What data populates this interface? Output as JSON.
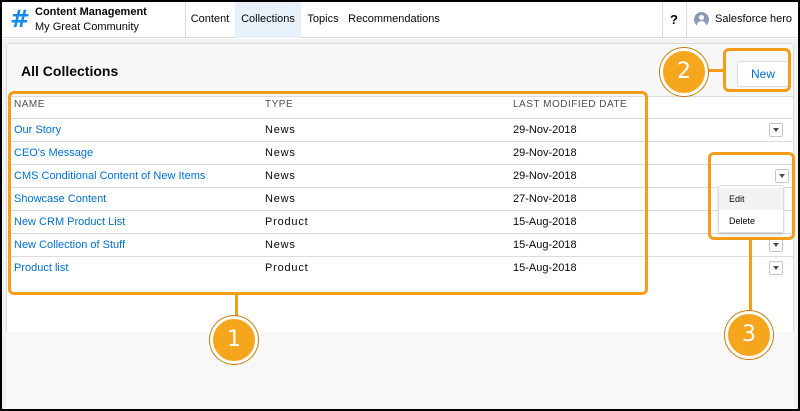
{
  "app": {
    "title": "Content Management",
    "community": "My Great Community"
  },
  "tabs": [
    {
      "label": "Content",
      "active": false
    },
    {
      "label": "Collections",
      "active": true
    },
    {
      "label": "Topics",
      "active": false
    },
    {
      "label": "Recommendations",
      "active": false
    }
  ],
  "header": {
    "help": "?",
    "user": "Salesforce hero"
  },
  "page": {
    "title": "All Collections",
    "new_button": "New"
  },
  "table": {
    "columns": [
      "NAME",
      "TYPE",
      "LAST MODIFIED DATE"
    ],
    "rows": [
      {
        "name": "Our Story",
        "type": "News",
        "date": "29-Nov-2018"
      },
      {
        "name": "CEO's Message",
        "type": "News",
        "date": "29-Nov-2018"
      },
      {
        "name": "CMS Conditional Content of New Items",
        "type": "News",
        "date": "29-Nov-2018"
      },
      {
        "name": "Showcase Content",
        "type": "News",
        "date": "27-Nov-2018"
      },
      {
        "name": "New CRM Product List",
        "type": "Product",
        "date": "15-Aug-2018"
      },
      {
        "name": "New Collection of Stuff",
        "type": "News",
        "date": "15-Aug-2018"
      },
      {
        "name": "Product list",
        "type": "Product",
        "date": "15-Aug-2018"
      }
    ]
  },
  "row_menu": {
    "items": [
      "Edit",
      "Delete"
    ]
  },
  "callouts": [
    "1",
    "2",
    "3"
  ],
  "colors": {
    "accent": "#0070d2",
    "callout": "#f59c1a",
    "logo": "#1589ee"
  }
}
